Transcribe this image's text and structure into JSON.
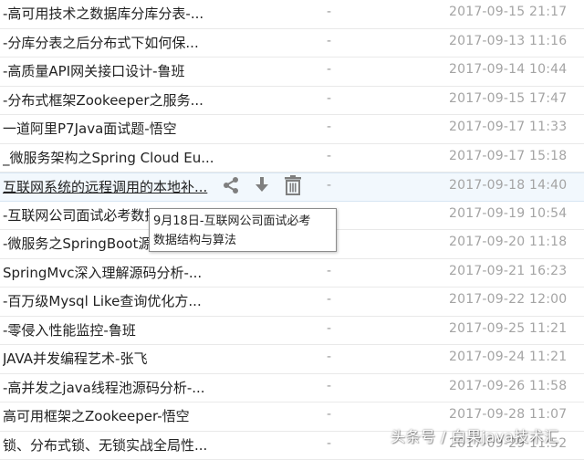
{
  "files": [
    {
      "name": "-高可用技术之数据库分库分表-...",
      "size": "-",
      "date": "2017-09-15 21:17"
    },
    {
      "name": "-分库分表之后分布式下如何保...",
      "size": "-",
      "date": "2017-09-13 11:16"
    },
    {
      "name": "-高质量API网关接口设计-鲁班",
      "size": "-",
      "date": "2017-09-14 10:44"
    },
    {
      "name": "-分布式框架Zookeeper之服务...",
      "size": "-",
      "date": "2017-09-15 17:47"
    },
    {
      "name": "一道阿里P7Java面试题-悟空",
      "size": "-",
      "date": "2017-09-17 11:33"
    },
    {
      "name": "_微服务架构之Spring Cloud Eu...",
      "size": "-",
      "date": "2017-09-17 15:18"
    },
    {
      "name": "互联网系统的远程调用的本地补...",
      "size": "-",
      "date": "2017-09-18 14:40",
      "hover": true
    },
    {
      "name": "-互联网公司面试必考数据结构...",
      "size": "-",
      "date": "2017-09-19 10:54"
    },
    {
      "name": "-微服务之SpringBoot源码剖析...",
      "size": "-",
      "date": "2017-09-20 11:18"
    },
    {
      "name": "SpringMvc深入理解源码分析-...",
      "size": "-",
      "date": "2017-09-21 16:23"
    },
    {
      "name": "-百万级Mysql Like查询优化方...",
      "size": "-",
      "date": "2017-09-22 12:00"
    },
    {
      "name": "-零侵入性能监控-鲁班",
      "size": "-",
      "date": "2017-09-25 11:21"
    },
    {
      "name": "JAVA并发编程艺术-张飞",
      "size": "-",
      "date": "2017-09-24 11:21"
    },
    {
      "name": "-高并发之java线程池源码分析-...",
      "size": "-",
      "date": "2017-09-26 11:58"
    },
    {
      "name": "高可用框架之Zookeeper-悟空",
      "size": "-",
      "date": "2017-09-28 11:07"
    },
    {
      "name": "锁、分布式锁、无锁实战全局性...",
      "size": "-",
      "date": "2017-09-29 11:52"
    }
  ],
  "tooltip": {
    "line1": "9月18日-互联网公司面试必考",
    "line2": "数据结构与算法"
  },
  "icons": {
    "share": "share-icon",
    "download": "download-icon",
    "delete": "trash-icon"
  },
  "colors": {
    "hover_bg": "#f2f8fd",
    "date_text": "#a4a4a4",
    "icon": "#7f7f7f"
  },
  "watermark": "头条号 / 白果java技术汇"
}
